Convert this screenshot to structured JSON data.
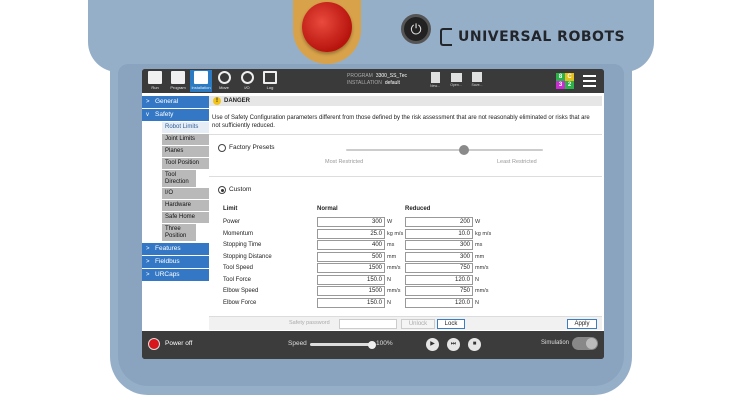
{
  "device": {
    "brand": "UNIVERSAL ROBOTS",
    "power_glyph": "⏻"
  },
  "topbar": {
    "tabs": [
      {
        "label": "Run",
        "icon": "run-icon"
      },
      {
        "label": "Program",
        "icon": "program-icon"
      },
      {
        "label": "Installation",
        "icon": "installation-icon"
      },
      {
        "label": "Move",
        "icon": "move-icon"
      },
      {
        "label": "I/O",
        "icon": "io-icon"
      },
      {
        "label": "Log",
        "icon": "log-icon"
      }
    ],
    "program_key": "PROGRAM",
    "program_value": "3300_SS_Tec",
    "installation_key": "INSTALLATION",
    "installation_value": "default",
    "file_buttons": [
      {
        "label": "New...",
        "icon": "new-file-icon"
      },
      {
        "label": "Open...",
        "icon": "open-folder-icon"
      },
      {
        "label": "Save...",
        "icon": "save-icon"
      }
    ],
    "status": [
      {
        "value": "8",
        "color": "#2bb34a"
      },
      {
        "value": "C",
        "color": "#e5c21b"
      },
      {
        "value": "3",
        "color": "#c72ecf"
      },
      {
        "value": "2",
        "color": "#2bb34a"
      }
    ]
  },
  "sidebar": {
    "general": "General",
    "safety": "Safety",
    "safety_items": [
      "Robot Limits",
      "Joint Limits",
      "Planes",
      "Tool Position",
      "Tool Direction",
      "I/O",
      "Hardware",
      "Safe Home",
      "Three Position"
    ],
    "features": "Features",
    "fieldbus": "Fieldbus",
    "urcaps": "URCaps"
  },
  "danger": {
    "title": "DANGER",
    "text": "Use of Safety Configuration parameters different from those defined by the risk assessment that are not reasonably eliminated or risks that are not sufficiently reduced."
  },
  "presets": {
    "factory_label": "Factory Presets",
    "most": "Most Restricted",
    "least": "Least Restricted",
    "slider_level": 0.6,
    "custom_label": "Custom"
  },
  "limits": {
    "col_limit": "Limit",
    "col_normal": "Normal",
    "col_reduced": "Reduced",
    "rows": [
      {
        "label": "Power",
        "normal": "300",
        "normal_unit": "W",
        "reduced": "200",
        "reduced_unit": "W"
      },
      {
        "label": "Momentum",
        "normal": "25.0",
        "normal_unit": "kg m/s",
        "reduced": "10.0",
        "reduced_unit": "kg m/s"
      },
      {
        "label": "Stopping Time",
        "normal": "400",
        "normal_unit": "ms",
        "reduced": "300",
        "reduced_unit": "ms"
      },
      {
        "label": "Stopping Distance",
        "normal": "500",
        "normal_unit": "mm",
        "reduced": "300",
        "reduced_unit": "mm"
      },
      {
        "label": "Tool Speed",
        "normal": "1500",
        "normal_unit": "mm/s",
        "reduced": "750",
        "reduced_unit": "mm/s"
      },
      {
        "label": "Tool Force",
        "normal": "150.0",
        "normal_unit": "N",
        "reduced": "120.0",
        "reduced_unit": "N"
      },
      {
        "label": "Elbow Speed",
        "normal": "1500",
        "normal_unit": "mm/s",
        "reduced": "750",
        "reduced_unit": "mm/s"
      },
      {
        "label": "Elbow Force",
        "normal": "150.0",
        "normal_unit": "N",
        "reduced": "120.0",
        "reduced_unit": "N"
      }
    ]
  },
  "bottom": {
    "password_label": "Safety password",
    "unlock": "Unlock",
    "lock": "Lock",
    "apply": "Apply"
  },
  "footer": {
    "power_off": "Power off",
    "speed_label": "Speed",
    "speed_value": "100%",
    "speed_level": 1.0,
    "play": "▶",
    "step": "⏭",
    "stop": "■",
    "simulation": "Simulation"
  }
}
